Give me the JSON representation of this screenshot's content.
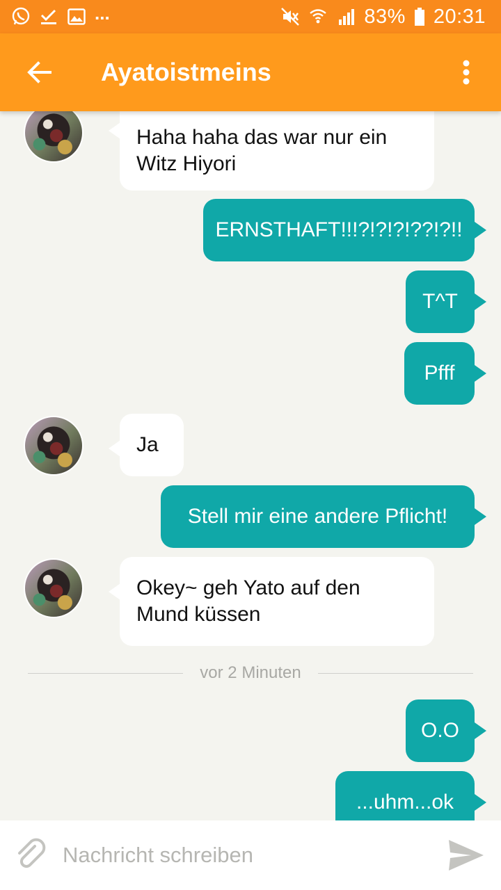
{
  "status_bar": {
    "battery_percent": "83%",
    "time": "20:31",
    "overflow": "..."
  },
  "header": {
    "title": "Ayatoistmeins"
  },
  "messages": [
    {
      "direction": "in",
      "lines": [
        "Haha haha das war nur ein",
        "Witz Hiyori"
      ]
    },
    {
      "direction": "out",
      "text": "ERNSTHAFT!!!?!?!?!??!?!!"
    },
    {
      "direction": "out",
      "text": "T^T"
    },
    {
      "direction": "out",
      "text": "Pfff"
    },
    {
      "direction": "in",
      "text": "Ja"
    },
    {
      "direction": "out",
      "text": "Stell mir eine andere Pflicht!"
    },
    {
      "direction": "in",
      "lines": [
        "Okey~ geh Yato auf den",
        "Mund küssen"
      ]
    },
    {
      "direction": "out",
      "text": "O.O"
    },
    {
      "direction": "out",
      "text": "...uhm...ok"
    }
  ],
  "time_divider": "vor 2 Minuten",
  "composer": {
    "placeholder": "Nachricht schreiben"
  },
  "colors": {
    "status_bar": "#f98a1c",
    "app_bar": "#ff9a1c",
    "outgoing_bubble": "#10a8a8",
    "incoming_bubble": "#ffffff",
    "background": "#f4f4ef"
  }
}
